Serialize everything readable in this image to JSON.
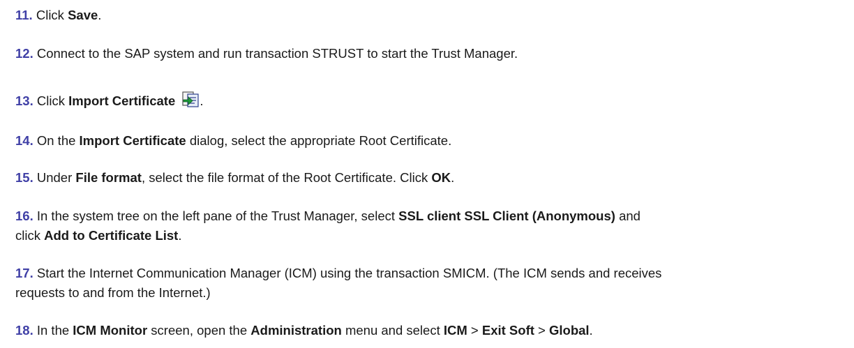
{
  "steps": [
    {
      "num": "11.",
      "p1": "Click ",
      "b1": "Save",
      "p2": "."
    },
    {
      "num": "12.",
      "text": "Connect to the SAP system and run transaction STRUST to start the Trust Manager."
    },
    {
      "num": "13.",
      "p1": "Click ",
      "b1": "Import Certificate",
      "p2": ".",
      "icon": "import-certificate-icon"
    },
    {
      "num": "14.",
      "p1": "On the ",
      "b1": "Import Certificate",
      "p2": " dialog, select the appropriate Root Certificate."
    },
    {
      "num": "15.",
      "p1": "Under ",
      "b1": "File format",
      "p2": ", select the file format of the Root Certificate. Click ",
      "b2": "OK",
      "p3": "."
    },
    {
      "num": "16.",
      "p1": "In the system tree on the left pane of the Trust Manager, select ",
      "b1": "SSL client SSL Client (Anonymous)",
      "p2": " and",
      "p3": "click ",
      "b2": "Add to Certificate List",
      "p4": "."
    },
    {
      "num": "17.",
      "line1": "Start the Internet Communication Manager (ICM) using the transaction SMICM. (The ICM sends and receives",
      "line2": "requests to and from the Internet.)"
    },
    {
      "num": "18.",
      "p1": "In the ",
      "b1": "ICM Monitor",
      "p2": " screen, open the ",
      "b2": "Administration",
      "p3": " menu and select ",
      "b3": "ICM",
      "p4": " > ",
      "b4": "Exit Soft",
      "p5": " > ",
      "b5": "Global",
      "p6": "."
    }
  ]
}
